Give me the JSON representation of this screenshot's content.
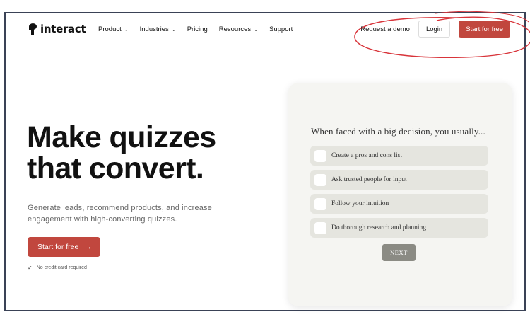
{
  "brand": {
    "name": "interact"
  },
  "nav": {
    "links": [
      {
        "label": "Product",
        "has_dropdown": true
      },
      {
        "label": "Industries",
        "has_dropdown": true
      },
      {
        "label": "Pricing",
        "has_dropdown": false
      },
      {
        "label": "Resources",
        "has_dropdown": true
      },
      {
        "label": "Support",
        "has_dropdown": false
      }
    ],
    "chevron": "⌄",
    "request_demo": "Request a demo",
    "login": "Login",
    "start_free": "Start for free"
  },
  "hero": {
    "title_line1": "Make quizzes",
    "title_line2": "that convert.",
    "subtitle": "Generate leads, recommend products, and increase engagement with high-converting quizzes.",
    "cta": "Start for free",
    "cta_arrow": "→",
    "note_check": "✓",
    "note": "No credit card required"
  },
  "quiz": {
    "question": "When faced with a big decision, you usually...",
    "options": [
      "Create a pros and cons list",
      "Ask trusted people for input",
      "Follow your intuition",
      "Do thorough research and planning"
    ],
    "next": "NEXT"
  },
  "colors": {
    "accent": "#c1473e",
    "annotation": "#d8343a",
    "frame": "#3a4256",
    "card_bg": "#f5f5f2",
    "option_bg": "#e5e5df",
    "next_bg": "#8b8b84"
  }
}
